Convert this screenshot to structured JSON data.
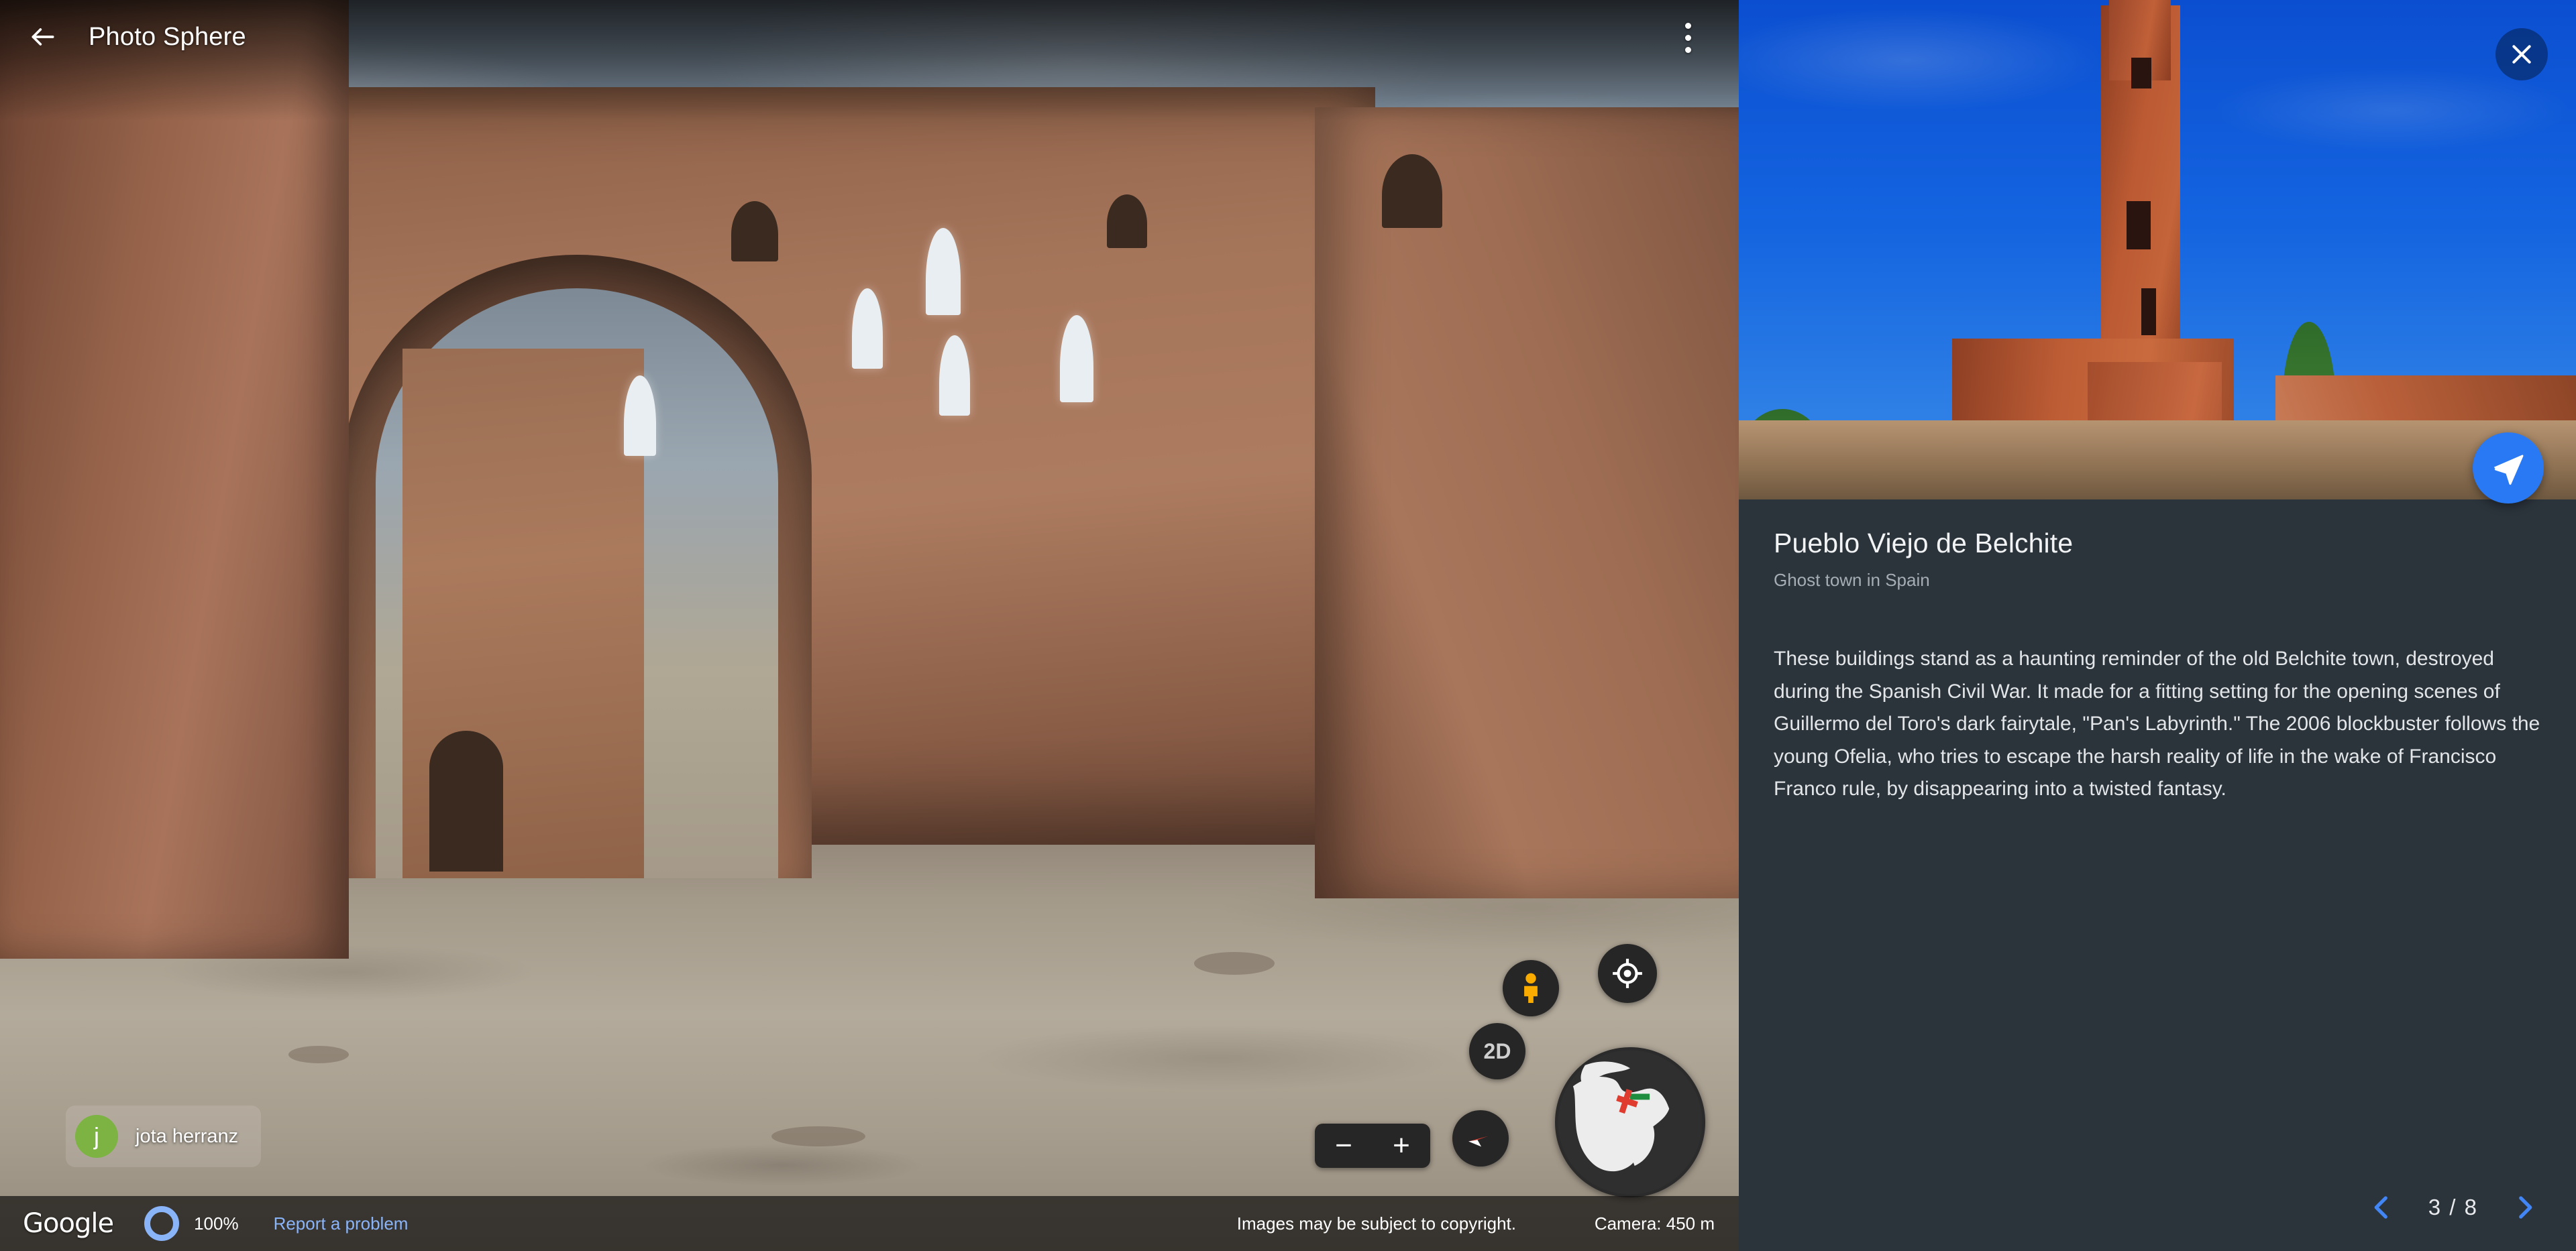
{
  "viewer": {
    "back_icon": "arrow-left-icon",
    "title": "Photo Sphere",
    "overflow_icon": "more-vertical-icon",
    "attribution": {
      "avatar_initial": "j",
      "avatar_color": "#7cb342",
      "author": "jota herranz"
    },
    "controls": {
      "pegman_icon": "pegman-icon",
      "locate_icon": "my-location-icon",
      "view_mode_label": "2D",
      "compass_icon": "compass-icon",
      "zoom_out_label": "−",
      "zoom_in_label": "+",
      "globe_icon": "globe-icon"
    },
    "statusbar": {
      "brand": "Google",
      "zoom_ring_icon": "zoom-ring-icon",
      "zoom_level": "100%",
      "report_link": "Report a problem",
      "copyright": "Images may be subject to copyright.",
      "camera": "Camera: 450 m"
    }
  },
  "panel": {
    "close_icon": "close-icon",
    "share_icon": "send-icon",
    "hero_alt": "Ruins of the church of San Martin de Tours, Belchite",
    "title": "Pueblo Viejo de Belchite",
    "subtitle": "Ghost town in Spain",
    "description": "These buildings stand as a haunting reminder of the old Belchite town, destroyed during the Spanish Civil War. It made for a fitting setting for the opening scenes of Guillermo del Toro's dark fairytale, \"Pan's Labyrinth.\" The 2006 blockbuster follows the young Ofelia, who tries to escape the harsh reality of life in the wake of Francisco Franco rule, by disappearing into a twisted fantasy.",
    "pager": {
      "prev_icon": "chevron-left-icon",
      "next_icon": "chevron-right-icon",
      "position": "3 / 8",
      "current": 3,
      "total": 8
    }
  },
  "colors": {
    "panel_bg": "#2b333b",
    "accent_blue": "#2979f5",
    "link_blue": "#8ab4f8",
    "avatar_green": "#7cb342"
  }
}
